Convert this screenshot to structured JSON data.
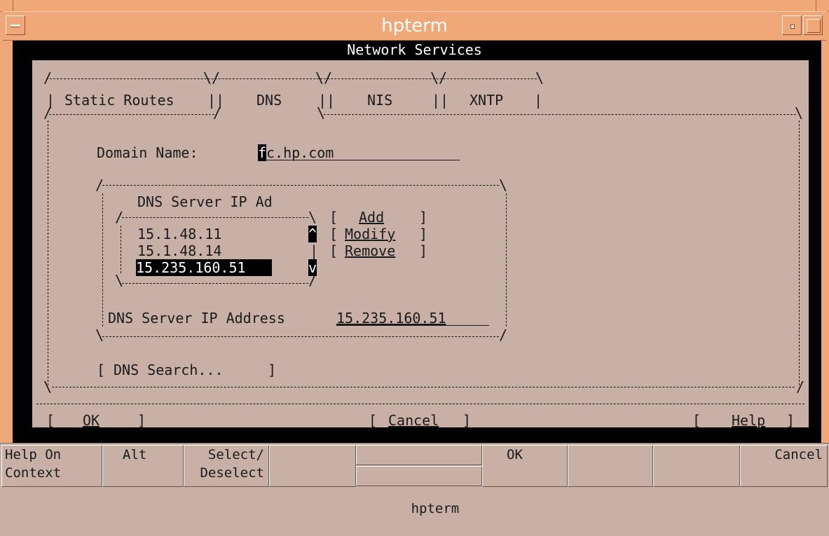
{
  "window": {
    "title": "hpterm"
  },
  "screen": {
    "title": "Network Services"
  },
  "tabs": [
    {
      "label": "Static Routes"
    },
    {
      "label": "DNS"
    },
    {
      "label": "NIS"
    },
    {
      "label": "XNTP"
    }
  ],
  "domain": {
    "label": "Domain Name:",
    "cursor_char": "f",
    "value_rest": "c.hp.com"
  },
  "dns_servers": {
    "group_label": "DNS Server IP Ad",
    "list": [
      "15.1.48.11",
      "15.1.48.14",
      "15.235.160.51"
    ],
    "selected_index": 2,
    "scroll_up": "^",
    "scroll_down": "v",
    "add_label": "Add",
    "modify_label": "Modify",
    "remove_label": "Remove",
    "field_label": "DNS Server IP Address",
    "field_value": "15.235.160.51"
  },
  "dns_search_label": "DNS Search...",
  "buttons": {
    "ok": "OK",
    "cancel": "Cancel",
    "help": "Help"
  },
  "softkeys": {
    "k1_line1": "Help On",
    "k1_line2": "Context",
    "k2": "Alt",
    "k3_line1": "Select/",
    "k3_line2": "Deselect",
    "k5": "hpterm",
    "k6": "OK",
    "k9": "Cancel"
  },
  "colors": {
    "title_bar": "#f0a878",
    "screen_bg": "#c9b0a6",
    "terminal_bg": "#000000"
  }
}
